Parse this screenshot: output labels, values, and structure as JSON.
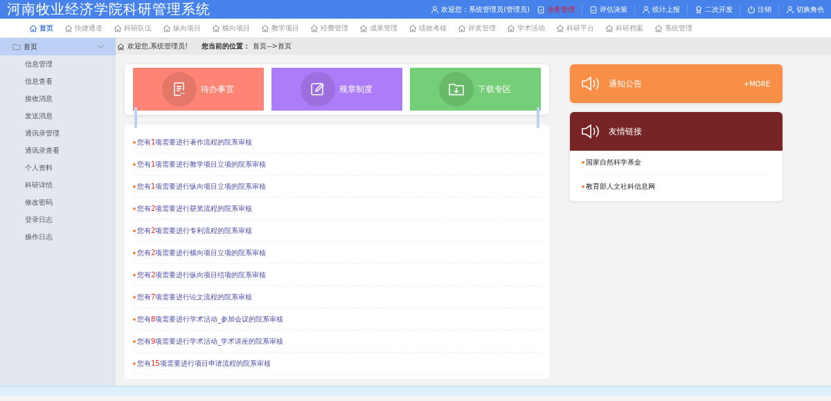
{
  "header": {
    "title": "河南牧业经济学院科研管理系统",
    "actions": [
      {
        "label": "欢迎您：系统管理员(管理员)",
        "selected": false
      },
      {
        "label": "业务管理",
        "selected": true
      },
      {
        "label": "评估决策",
        "selected": false
      },
      {
        "label": "统计上报",
        "selected": false
      },
      {
        "label": "二次开发",
        "selected": false
      },
      {
        "label": "注销",
        "selected": false
      },
      {
        "label": "切换角色",
        "selected": false
      }
    ]
  },
  "nav": [
    {
      "label": "首页",
      "selected": true
    },
    {
      "label": "快捷通道",
      "selected": false
    },
    {
      "label": "科研队伍",
      "selected": false
    },
    {
      "label": "纵向项目",
      "selected": false
    },
    {
      "label": "横向项目",
      "selected": false
    },
    {
      "label": "教学项目",
      "selected": false
    },
    {
      "label": "经费管理",
      "selected": false
    },
    {
      "label": "成果管理",
      "selected": false
    },
    {
      "label": "绩效考核",
      "selected": false
    },
    {
      "label": "评奖管理",
      "selected": false
    },
    {
      "label": "学术活动",
      "selected": false
    },
    {
      "label": "科研平台",
      "selected": false
    },
    {
      "label": "科研档案",
      "selected": false
    },
    {
      "label": "系统管理",
      "selected": false
    }
  ],
  "sidebar": {
    "title": "首页",
    "expanded": true,
    "items": [
      "信息管理",
      "信息查看",
      "接收消息",
      "发送消息",
      "通讯录管理",
      "通讯录查看",
      "个人资料",
      "科研详情",
      "修改密码",
      "登录日志",
      "操作日志"
    ]
  },
  "breadcrumb": {
    "welcome": "欢迎您,系统管理员!",
    "label": "您当前的位置：",
    "path": "首页-->首页"
  },
  "tiles": [
    {
      "label": "待办事宜",
      "color": "#fe8576"
    },
    {
      "label": "规章制度",
      "color": "#ad7cf8"
    },
    {
      "label": "下载专区",
      "color": "#75cf78"
    }
  ],
  "todos": [
    {
      "prefix": "您有",
      "count": "1",
      "suffix": "项需要进行著作流程的院系审核"
    },
    {
      "prefix": "您有",
      "count": "1",
      "suffix": "项需要进行教学项目立项的院系审核"
    },
    {
      "prefix": "您有",
      "count": "1",
      "suffix": "项需要进行纵向项目立项的院系审核"
    },
    {
      "prefix": "您有",
      "count": "2",
      "suffix": "项需要进行获奖流程的院系审核"
    },
    {
      "prefix": "您有",
      "count": "2",
      "suffix": "项需要进行专利流程的院系审核"
    },
    {
      "prefix": "您有",
      "count": "2",
      "suffix": "项需要进行横向项目立项的院系审核"
    },
    {
      "prefix": "您有",
      "count": "2",
      "suffix": "项需要进行纵向项目结项的院系审核"
    },
    {
      "prefix": "您有",
      "count": "7",
      "suffix": "项需要进行论文流程的院系审核"
    },
    {
      "prefix": "您有",
      "count": "8",
      "suffix": "项需要进行学术活动_参加会议的院系审核"
    },
    {
      "prefix": "您有",
      "count": "9",
      "suffix": "项需要进行学术活动_学术讲座的院系审核"
    },
    {
      "prefix": "您有",
      "count": "15",
      "suffix": "项需要进行项目申请流程的院系审核"
    }
  ],
  "notice": {
    "title": "通知公告",
    "more": "+MORE"
  },
  "links": {
    "title": "友情链接",
    "items": [
      "国家自然科学基金",
      "教育部人文社科信息网"
    ]
  }
}
